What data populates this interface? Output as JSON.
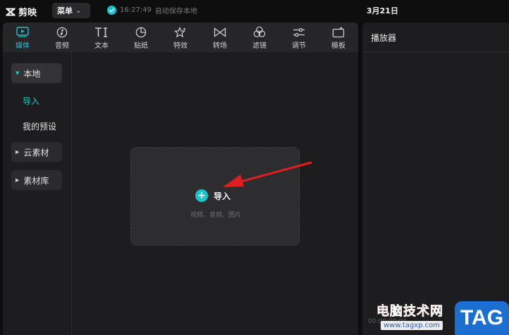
{
  "app": {
    "name": "剪映"
  },
  "topbar": {
    "menu_label": "菜单",
    "save_time": "16:27:49",
    "save_status": "自动保存本地",
    "project_title": "3月21日"
  },
  "toolbar": {
    "items": [
      {
        "label": "媒体",
        "icon": "media-icon",
        "active": true
      },
      {
        "label": "音频",
        "icon": "audio-icon",
        "active": false
      },
      {
        "label": "文本",
        "icon": "text-icon",
        "active": false
      },
      {
        "label": "贴纸",
        "icon": "sticker-icon",
        "active": false
      },
      {
        "label": "特效",
        "icon": "effects-icon",
        "active": false
      },
      {
        "label": "转场",
        "icon": "transition-icon",
        "active": false
      },
      {
        "label": "滤镜",
        "icon": "filter-icon",
        "active": false
      },
      {
        "label": "调节",
        "icon": "adjust-icon",
        "active": false
      },
      {
        "label": "模板",
        "icon": "template-icon",
        "active": false
      }
    ]
  },
  "sidebar": {
    "local": "本地",
    "local_children": [
      "导入",
      "我的预设"
    ],
    "cloud": "云素材",
    "library": "素材库"
  },
  "import": {
    "label": "导入",
    "hint": "视频、音频、图片"
  },
  "player": {
    "title": "播放器",
    "timecode": "00:00:00:00"
  },
  "watermark": {
    "title": "电脑技术网",
    "url": "www.tagxp.com",
    "tag": "TAG"
  },
  "colors": {
    "accent": "#1cc4c9",
    "panel": "#1d1d1f",
    "background": "#0e0e0f",
    "arrow": "#e11d1d"
  }
}
